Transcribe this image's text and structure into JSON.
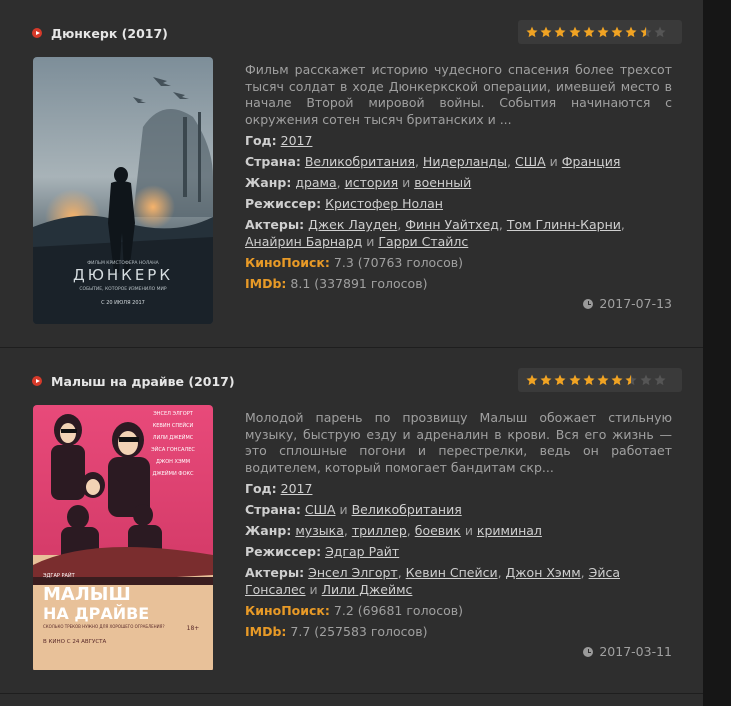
{
  "films": [
    {
      "title": "Дюнкерк (2017)",
      "rating_stars": 8.5,
      "rating_max": 10,
      "description": "Фильм расскажет историю чудесного спасения более трехсот тысяч солдат в ходе Дюнкеркской операции, имевшей место в начале Второй мировой войны. События начинаются с окружения сотен тысяч британских и ...",
      "year_label": "Год:",
      "year": "2017",
      "country_label": "Страна:",
      "countries": [
        "Великобритания",
        "Нидерланды",
        "США",
        "Франция"
      ],
      "genre_label": "Жанр:",
      "genres": [
        "драма",
        "история",
        "военный"
      ],
      "director_label": "Режиссер:",
      "director": "Кристофер Нолан",
      "actors_label": "Актеры:",
      "actors": [
        "Джек Лауден",
        "Финн Уайтхед",
        "Том Глинн-Карни",
        "Анайрин Барнард",
        "Гарри Стайлс"
      ],
      "kp_label": "КиноПоиск:",
      "kp_value": "7.3 (70763 голосов)",
      "imdb_label": "IMDb:",
      "imdb_value": "8.1 (337891 голосов)",
      "date": "2017-07-13",
      "poster": {
        "title": "ДЮНКЕРК",
        "tagline": "СОБЫТИЕ, КОТОРОЕ ИЗМЕНИЛО МИР",
        "credit": "ФИЛЬМ КРИСТОФЕРА НОЛАНА",
        "release": "С 20 ИЮЛЯ 2017"
      }
    },
    {
      "title": "Малыш на драйве (2017)",
      "rating_stars": 7.5,
      "rating_max": 10,
      "description": "Молодой парень по прозвищу Малыш обожает стильную музыку, быструю езду и адреналин в крови. Вся его жизнь — это сплошные погони и перестрелки, ведь он работает водителем, который помогает бандитам скр...",
      "year_label": "Год:",
      "year": "2017",
      "country_label": "Страна:",
      "countries": [
        "США",
        "Великобритания"
      ],
      "genre_label": "Жанр:",
      "genres": [
        "музыка",
        "триллер",
        "боевик",
        "криминал"
      ],
      "director_label": "Режиссер:",
      "director": "Эдгар Райт",
      "actors_label": "Актеры:",
      "actors": [
        "Энсел Элгорт",
        "Кевин Спейси",
        "Джон Хэмм",
        "Эйса Гонсалес",
        "Лили Джеймс"
      ],
      "kp_label": "КиноПоиск:",
      "kp_value": "7.2 (69681 голосов)",
      "imdb_label": "IMDb:",
      "imdb_value": "7.7 (257583 голосов)",
      "date": "2017-03-11",
      "poster": {
        "title_line1": "МАЛЫШ",
        "title_line2": "НА ДРАЙВЕ",
        "director_name": "ЭДГАР РАЙТ",
        "tagline": "СКОЛЬКО ТРЕКОВ НУЖНО ДЛЯ ХОРОШЕГО ОГРАБЛЕНИЯ?",
        "release": "В КИНО С 24 АВГУСТА",
        "age": "18+",
        "cast": [
          "ЭНСЕЛ ЭЛГОРТ",
          "КЕВИН СПЕЙСИ",
          "ЛИЛИ ДЖЕЙМС",
          "ЭЙСА ГОНСАЛЕС",
          "ДЖОН ХЭММ",
          "ДЖЕЙМИ ФОКС"
        ]
      }
    }
  ],
  "colors": {
    "accent_orange": "#e89a27",
    "play_red": "#d63a2a",
    "star_filled": "#f0a323",
    "star_empty": "#555555"
  }
}
